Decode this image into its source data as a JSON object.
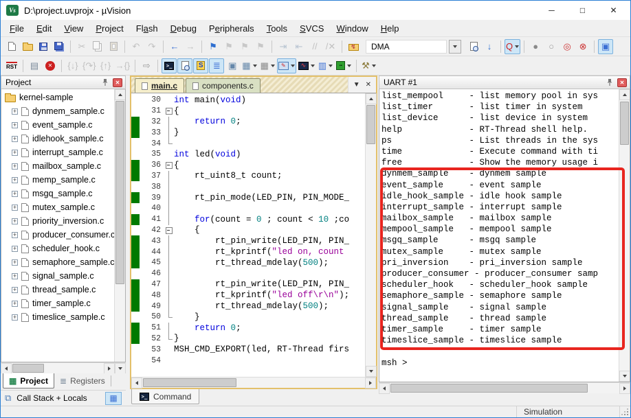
{
  "window": {
    "title": "D:\\project.uvprojx - µVision",
    "icon_text": "Vs",
    "controls": [
      {
        "n": "minimize-button",
        "g": "─"
      },
      {
        "n": "maximize-button",
        "g": "□"
      },
      {
        "n": "close-button",
        "g": "✕"
      }
    ]
  },
  "menu": {
    "items": [
      {
        "label": "File",
        "u": 0
      },
      {
        "label": "Edit",
        "u": 0
      },
      {
        "label": "View",
        "u": 0
      },
      {
        "label": "Project",
        "u": 0
      },
      {
        "label": "Flash",
        "u": 2
      },
      {
        "label": "Debug",
        "u": 0
      },
      {
        "label": "Peripherals",
        "u": 1
      },
      {
        "label": "Tools",
        "u": 0
      },
      {
        "label": "SVCS",
        "u": 0
      },
      {
        "label": "Window",
        "u": 0
      },
      {
        "label": "Help",
        "u": 0
      }
    ]
  },
  "toolbar1": {
    "items": [
      {
        "n": "new-file-button",
        "cls": "pg"
      },
      {
        "n": "open-file-button",
        "cls": "fld"
      },
      {
        "n": "save-button",
        "cls": "flp"
      },
      {
        "n": "save-all-button",
        "cls": "flp2"
      },
      {
        "t": "sep"
      },
      {
        "n": "cut-button",
        "g": "✂",
        "c": "#9a9a9a",
        "dis": 1
      },
      {
        "n": "copy-button",
        "cls": "pg2",
        "dis": 1
      },
      {
        "n": "paste-button",
        "cls": "clip",
        "dis": 1
      },
      {
        "t": "sep"
      },
      {
        "n": "undo-button",
        "g": "↶",
        "c": "#9a9a9a",
        "dis": 1
      },
      {
        "n": "redo-button",
        "g": "↷",
        "c": "#9a9a9a",
        "dis": 1
      },
      {
        "t": "sep"
      },
      {
        "n": "navigate-back-button",
        "g": "←",
        "c": "#3b6fd4"
      },
      {
        "n": "navigate-forward-button",
        "g": "→",
        "c": "#9a9a9a",
        "dis": 1
      },
      {
        "t": "sep"
      },
      {
        "n": "bookmark-toggle-button",
        "g": "⚑",
        "c": "#2f6fd0"
      },
      {
        "n": "bookmark-prev-button",
        "g": "⚑",
        "c": "#a8a8a8",
        "dis": 1
      },
      {
        "n": "bookmark-next-button",
        "g": "⚑",
        "c": "#a8a8a8",
        "dis": 1
      },
      {
        "n": "bookmark-clear-button",
        "g": "⚑",
        "c": "#a8a8a8",
        "dis": 1
      },
      {
        "t": "sep"
      },
      {
        "n": "indent-button",
        "g": "⇥",
        "c": "#8aa0b8",
        "dis": 1
      },
      {
        "n": "outdent-button",
        "g": "⇤",
        "c": "#8aa0b8",
        "dis": 1
      },
      {
        "n": "comment-button",
        "g": "//",
        "c": "#9a9a9a",
        "dis": 1
      },
      {
        "n": "uncomment-button",
        "g": "/✕",
        "c": "#9a9a9a",
        "dis": 1
      },
      {
        "t": "sep"
      },
      {
        "n": "flash-download-button",
        "cls": "fldz",
        "g": "↯"
      },
      {
        "t": "combo",
        "n": "target-select",
        "v": "DMA"
      },
      {
        "n": "find-in-files-button",
        "cls": "pgs"
      },
      {
        "n": "incremental-find-button",
        "g": "↓",
        "c": "#2f6fd0"
      },
      {
        "t": "sep"
      },
      {
        "n": "quick-find-button",
        "g": "Q",
        "c": "#cc2020",
        "hl": 1,
        "dd": 1
      },
      {
        "t": "sep"
      },
      {
        "n": "insert-breakpoint-button",
        "g": "●",
        "c": "#8a8a8a"
      },
      {
        "n": "enable-breakpoint-button",
        "g": "○",
        "c": "#9a9a9a"
      },
      {
        "n": "disable-all-breakpoints-button",
        "g": "◎",
        "c": "#cc3333"
      },
      {
        "n": "kill-all-breakpoints-button",
        "g": "⊗",
        "c": "#cc3333"
      },
      {
        "t": "sep"
      },
      {
        "n": "windows-layout-button",
        "g": "▣",
        "c": "#3b6fd4",
        "hl": 1
      }
    ]
  },
  "toolbar2": {
    "items": [
      {
        "n": "reset-button",
        "cls": "rsti",
        "g": "RST"
      },
      {
        "t": "sep"
      },
      {
        "n": "show-next-statement-button",
        "g": "▤",
        "c": "#7a8a9a"
      },
      {
        "n": "stop-debug-button",
        "cls": "stopbtn",
        "g": "✕"
      },
      {
        "t": "sep"
      },
      {
        "n": "step-button",
        "g": "{↓}",
        "c": "#9a9a9a",
        "dis": 1
      },
      {
        "n": "step-over-button",
        "g": "{↷}",
        "c": "#9a9a9a",
        "dis": 1
      },
      {
        "n": "step-out-button",
        "g": "{↑}",
        "c": "#9a9a9a",
        "dis": 1
      },
      {
        "n": "run-to-line-button",
        "g": "→{}",
        "c": "#9a9a9a",
        "dis": 1
      },
      {
        "t": "sep"
      },
      {
        "n": "run-button",
        "g": "⇨",
        "c": "#9a9a9a"
      },
      {
        "t": "sep"
      },
      {
        "n": "command-window-button",
        "cls": "consoleb",
        "g": ">_",
        "hl": 1
      },
      {
        "n": "disassembly-window-button",
        "cls": "pgs",
        "hl": 1
      },
      {
        "n": "symbols-window-button",
        "cls": "sdoc",
        "g": "S",
        "hl": 1
      },
      {
        "n": "registers-window-button",
        "g": "≣",
        "c": "#3b6fd4",
        "hl": 1
      },
      {
        "n": "callstack-window-button",
        "g": "▣",
        "c": "#6688aa"
      },
      {
        "n": "watch-window-button",
        "g": "▦",
        "c": "#6688aa",
        "dd": 1
      },
      {
        "n": "memory-window-button",
        "g": "▦",
        "c": "#8a8a8a",
        "dd": 1
      },
      {
        "n": "serial-window-button",
        "cls": "ser",
        "g": "✎",
        "hl": 1,
        "dd": 1
      },
      {
        "n": "analysis-window-button",
        "cls": "ana",
        "g": "∿",
        "dd": 1
      },
      {
        "n": "system-viewer-button",
        "g": "▥",
        "c": "#3b6fd4",
        "dd": 1
      },
      {
        "n": "peripherals-button",
        "cls": "per",
        "g": "▪▪",
        "dd": 1
      },
      {
        "t": "sep"
      },
      {
        "n": "toolbox-button",
        "g": "⚒",
        "c": "#8a7a3a",
        "dd": 1
      }
    ]
  },
  "project_panel": {
    "title": "Project",
    "root": "kernel-sample",
    "files": [
      "dynmem_sample.c",
      "event_sample.c",
      "idlehook_sample.c",
      "interrupt_sample.c",
      "mailbox_sample.c",
      "memp_sample.c",
      "msgq_sample.c",
      "mutex_sample.c",
      "priority_inversion.c",
      "producer_consumer.c",
      "scheduler_hook.c",
      "semaphore_sample.c",
      "signal_sample.c",
      "thread_sample.c",
      "timer_sample.c",
      "timeslice_sample.c"
    ],
    "tabs": [
      {
        "label": "Project",
        "icon": "▦",
        "icon_color": "#2e8b57",
        "active": true
      },
      {
        "label": "Registers",
        "icon": "≣",
        "icon_color": "#7a8a9a",
        "active": false
      }
    ],
    "callstack_label": "Call Stack + Locals",
    "callstack_icon": "⧉",
    "calc_icon": "▦"
  },
  "editor": {
    "tabs": [
      {
        "label": "main.c",
        "active": true
      },
      {
        "label": "components.c",
        "active": false
      }
    ],
    "menu_button_glyph": "▼",
    "close_button_glyph": "✕",
    "lines": [
      {
        "no": 30,
        "bar": 0,
        "fold": "",
        "tk": [
          [
            "k",
            "int"
          ],
          [
            "p",
            " main("
          ],
          [
            "k",
            "void"
          ],
          [
            "p",
            ")"
          ]
        ]
      },
      {
        "no": 31,
        "bar": 0,
        "fold": "box",
        "tk": [
          [
            "p",
            "{"
          ]
        ]
      },
      {
        "no": 32,
        "bar": 1,
        "fold": "v",
        "tk": [
          [
            "p",
            "    "
          ],
          [
            "k",
            "return"
          ],
          [
            "p",
            " "
          ],
          [
            "n",
            "0"
          ],
          [
            "p",
            ";"
          ]
        ]
      },
      {
        "no": 33,
        "bar": 1,
        "fold": "v",
        "tk": [
          [
            "p",
            "}"
          ]
        ]
      },
      {
        "no": 34,
        "bar": 0,
        "fold": "end",
        "tk": []
      },
      {
        "no": 35,
        "bar": 0,
        "fold": "",
        "tk": [
          [
            "k",
            "int"
          ],
          [
            "p",
            " led("
          ],
          [
            "k",
            "void"
          ],
          [
            "p",
            ")"
          ]
        ]
      },
      {
        "no": 36,
        "bar": 1,
        "fold": "box",
        "tk": [
          [
            "p",
            "{"
          ]
        ]
      },
      {
        "no": 37,
        "bar": 1,
        "fold": "v",
        "tk": [
          [
            "p",
            "    rt_uint8_t count;"
          ]
        ]
      },
      {
        "no": 38,
        "bar": 0,
        "fold": "v",
        "tk": []
      },
      {
        "no": 39,
        "bar": 1,
        "fold": "v",
        "tk": [
          [
            "p",
            "    rt_pin_mode(LED_PIN, PIN_MODE_"
          ]
        ]
      },
      {
        "no": 40,
        "bar": 0,
        "fold": "v",
        "tk": []
      },
      {
        "no": 41,
        "bar": 1,
        "fold": "v",
        "tk": [
          [
            "p",
            "    "
          ],
          [
            "k",
            "for"
          ],
          [
            "p",
            "(count = "
          ],
          [
            "n",
            "0"
          ],
          [
            "p",
            " ; count < "
          ],
          [
            "n",
            "10"
          ],
          [
            "p",
            " ;co"
          ]
        ]
      },
      {
        "no": 42,
        "bar": 0,
        "fold": "box",
        "tk": [
          [
            "p",
            "    {"
          ]
        ]
      },
      {
        "no": 43,
        "bar": 1,
        "fold": "v",
        "tk": [
          [
            "p",
            "        rt_pin_write(LED_PIN, PIN_"
          ]
        ]
      },
      {
        "no": 44,
        "bar": 1,
        "fold": "v",
        "tk": [
          [
            "p",
            "        rt_kprintf("
          ],
          [
            "s",
            "\"led on, count"
          ]
        ]
      },
      {
        "no": 45,
        "bar": 1,
        "fold": "v",
        "tk": [
          [
            "p",
            "        rt_thread_mdelay("
          ],
          [
            "n",
            "500"
          ],
          [
            "p",
            ");"
          ]
        ]
      },
      {
        "no": 46,
        "bar": 0,
        "fold": "v",
        "tk": []
      },
      {
        "no": 47,
        "bar": 1,
        "fold": "v",
        "tk": [
          [
            "p",
            "        rt_pin_write(LED_PIN, PIN_"
          ]
        ]
      },
      {
        "no": 48,
        "bar": 1,
        "fold": "v",
        "tk": [
          [
            "p",
            "        rt_kprintf("
          ],
          [
            "s",
            "\"led off\\r\\n\""
          ],
          [
            "p",
            ");"
          ]
        ]
      },
      {
        "no": 49,
        "bar": 1,
        "fold": "v",
        "tk": [
          [
            "p",
            "        rt_thread_mdelay("
          ],
          [
            "n",
            "500"
          ],
          [
            "p",
            ");"
          ]
        ]
      },
      {
        "no": 50,
        "bar": 0,
        "fold": "end",
        "tk": [
          [
            "p",
            "    }"
          ]
        ]
      },
      {
        "no": 51,
        "bar": 1,
        "fold": "v",
        "tk": [
          [
            "p",
            "    "
          ],
          [
            "k",
            "return"
          ],
          [
            "p",
            " "
          ],
          [
            "n",
            "0"
          ],
          [
            "p",
            ";"
          ]
        ]
      },
      {
        "no": 52,
        "bar": 1,
        "fold": "end",
        "tk": [
          [
            "p",
            "}"
          ]
        ]
      },
      {
        "no": 53,
        "bar": 0,
        "fold": "",
        "tk": [
          [
            "p",
            "MSH_CMD_EXPORT(led, RT-Thread firs"
          ]
        ]
      },
      {
        "no": 54,
        "bar": 0,
        "fold": "",
        "tk": []
      }
    ]
  },
  "command_panel": {
    "label": "Command",
    "icon": ">_"
  },
  "uart": {
    "title": "UART #1",
    "lines": [
      "list_mempool     - list memory pool in sys",
      "list_timer       - list timer in system",
      "list_device      - list device in system",
      "help             - RT-Thread shell help.",
      "ps               - List threads in the sys",
      "time             - Execute command with ti",
      "free             - Show the memory usage i",
      "dynmem_sample    - dynmem sample",
      "event_sample     - event sample",
      "idle_hook_sample - idle hook sample",
      "interrupt_sample - interrupt sample",
      "mailbox_sample   - mailbox sample",
      "mempool_sample   - mempool sample",
      "msgq_sample      - msgq sample",
      "mutex_sample     - mutex sample",
      "pri_inversion    - pri_inversion sample",
      "producer_consumer - producer_consumer samp",
      "scheduler_hook   - scheduler_hook sample",
      "semaphore_sample - semaphore sample",
      "signal_sample    - signal sample",
      "thread_sample    - thread sample",
      "timer_sample     - timer sample",
      "timeslice_sample - timeslice sample",
      "",
      "msh >"
    ]
  },
  "status": {
    "simulation": "Simulation"
  },
  "colors": {
    "keyword": "#0000dd",
    "number": "#008080",
    "string": "#990099",
    "changebar": "#007a00",
    "annotation": "#e8251f",
    "window_border": "#2a7fd4",
    "highlight_bg": "#cde6f7",
    "highlight_border": "#7ab0dd",
    "tab_active_bg": "#f5eecb",
    "tab_inactive_bg": "#d9e0c3"
  }
}
